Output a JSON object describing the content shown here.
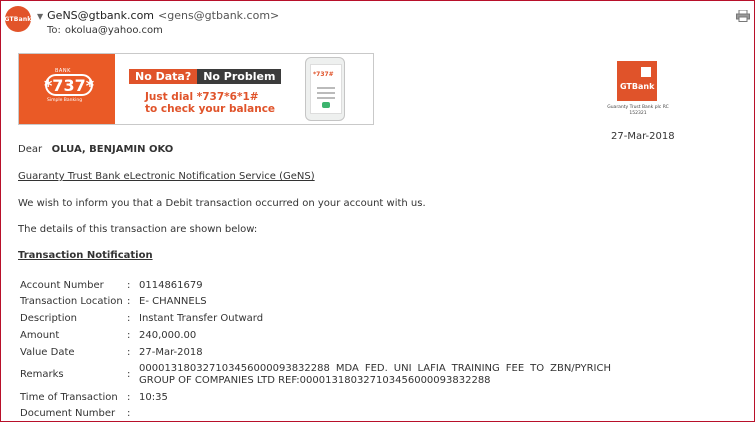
{
  "header": {
    "avatar_text": "GTBank",
    "sender_name": "GeNS@gtbank.com",
    "sender_address": "<gens@gtbank.com>",
    "to_label": "To:",
    "to_address": "okolua@yahoo.com"
  },
  "banner": {
    "code": "*737*",
    "bank_label": "BANK",
    "sub_label": "Simple Banking",
    "no_data": "No Data?",
    "no_problem": "No Problem",
    "dial_line1": "Just dial *737*6*1#",
    "dial_line2": "to check your balance",
    "phone_screen_text": "*737#"
  },
  "logo": {
    "text": "GTBank",
    "caption": "Guaranty Trust Bank plc RC 152321"
  },
  "date": "27-Mar-2018",
  "greeting": {
    "dear": "Dear",
    "name": "OLUA, BENJAMIN OKO"
  },
  "service_title": "Guaranty Trust Bank eLectronic Notification Service (GeNS)",
  "para1": "We wish to inform you that a Debit transaction occurred on your account with us.",
  "para2": "The details of this transaction are shown below:",
  "section_title": "Transaction Notification",
  "colon": ":",
  "transaction": {
    "account_number_label": "Account Number",
    "account_number": "0114861679",
    "location_label": "Transaction Location",
    "location": "E- CHANNELS",
    "description_label": "Description",
    "description": "Instant Transfer Outward",
    "amount_label": "Amount",
    "amount": "240,000.00",
    "value_date_label": "Value Date",
    "value_date": "27-Mar-2018",
    "remarks_label": "Remarks",
    "remarks": "000013180327103456000093832288 MDA FED. UNI LAFIA TRAINING FEE TO ZBN/PYRICH GROUP OF COMPANIES LTD REF:000013180327103456000093832288",
    "time_label": "Time of Transaction",
    "time": "10:35",
    "document_label": "Document Number",
    "document": ""
  },
  "colors": {
    "brand": "#e0532a",
    "frame": "#b8102a"
  },
  "icons": [
    "gtbank-avatar-icon",
    "print-icon",
    "gtbank-logo-icon",
    "phone-icon"
  ]
}
